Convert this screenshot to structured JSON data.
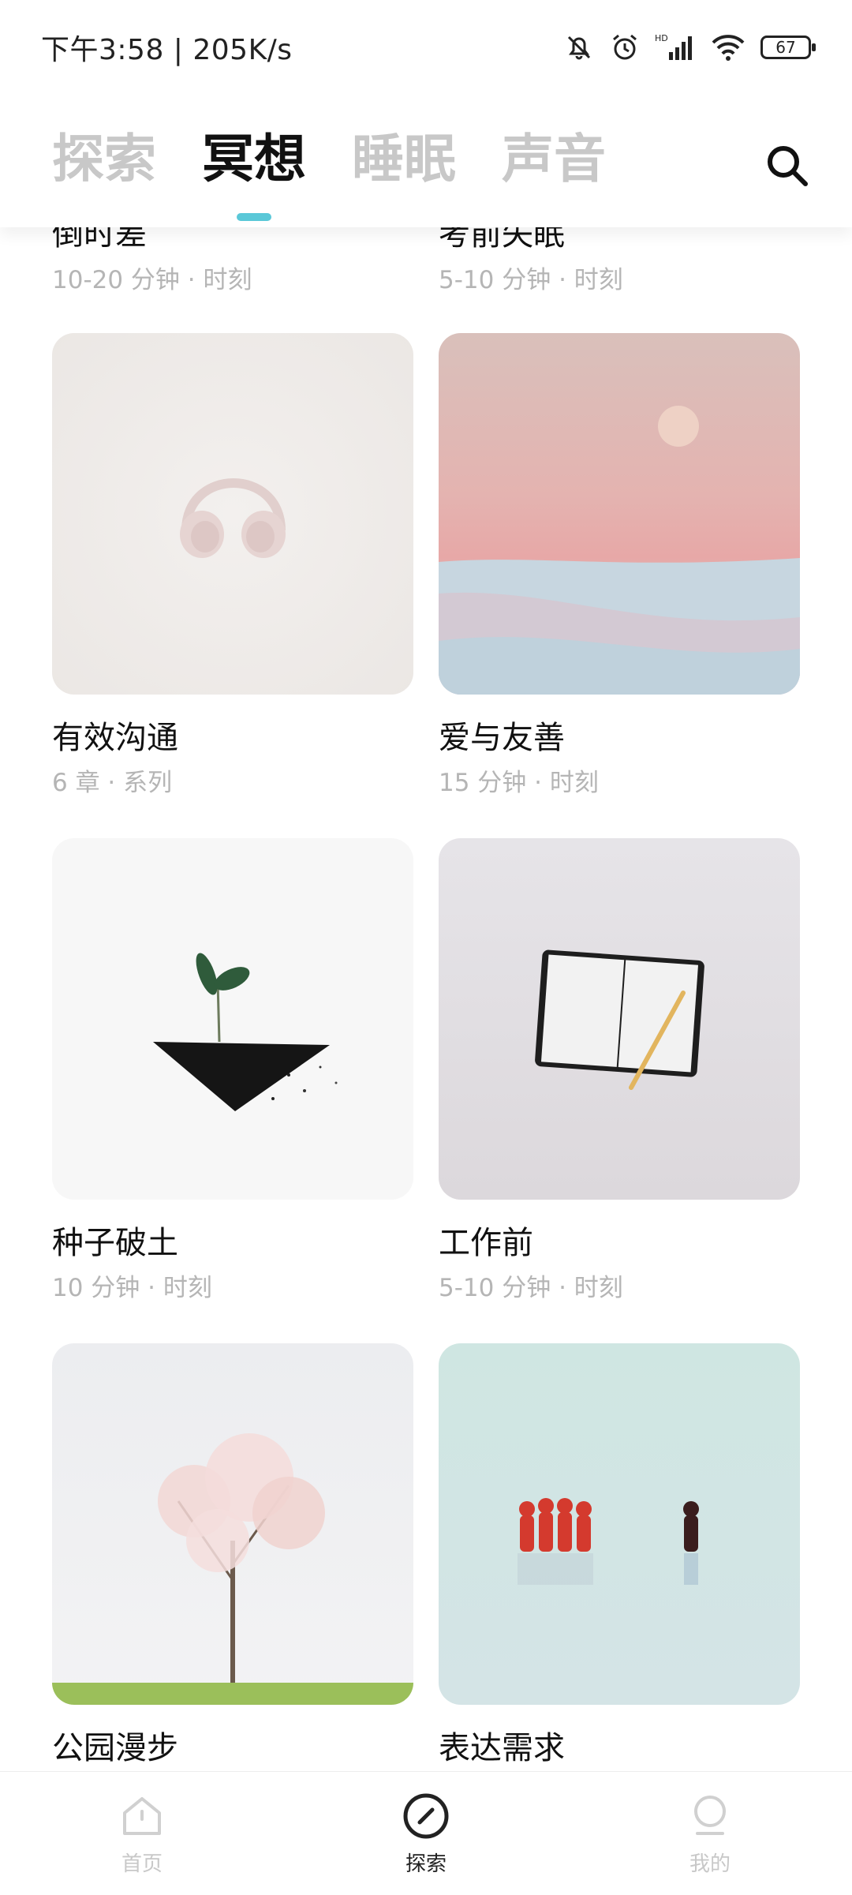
{
  "status_bar": {
    "time_speed": "下午3:58 | 205K/s",
    "battery": "67",
    "icons": [
      "mute-bell-icon",
      "alarm-icon",
      "hd-signal-icon",
      "wifi-icon",
      "battery-icon"
    ]
  },
  "tabs": [
    {
      "label": "探索"
    },
    {
      "label": "冥想"
    },
    {
      "label": "睡眠"
    },
    {
      "label": "声音"
    }
  ],
  "colors": {
    "accent": "#5ac8d8",
    "inactive": "#c8c8c8"
  },
  "top_row": [
    {
      "title": "倒时差",
      "meta": "10-20 分钟 · 时刻"
    },
    {
      "title": "考前失眠",
      "meta": "5-10 分钟 · 时刻"
    }
  ],
  "cards": [
    {
      "title": "有效沟通",
      "meta": "6 章 · 系列"
    },
    {
      "title": "爱与友善",
      "meta": "15 分钟 · 时刻"
    },
    {
      "title": "种子破土",
      "meta": "10 分钟 · 时刻"
    },
    {
      "title": "工作前",
      "meta": "5-10 分钟 · 时刻"
    },
    {
      "title": "公园漫步",
      "meta": ""
    },
    {
      "title": "表达需求",
      "meta": ""
    }
  ],
  "bottom_nav": [
    {
      "label": "首页",
      "icon": "home-icon"
    },
    {
      "label": "探索",
      "icon": "compass-icon"
    },
    {
      "label": "我的",
      "icon": "profile-icon"
    }
  ]
}
